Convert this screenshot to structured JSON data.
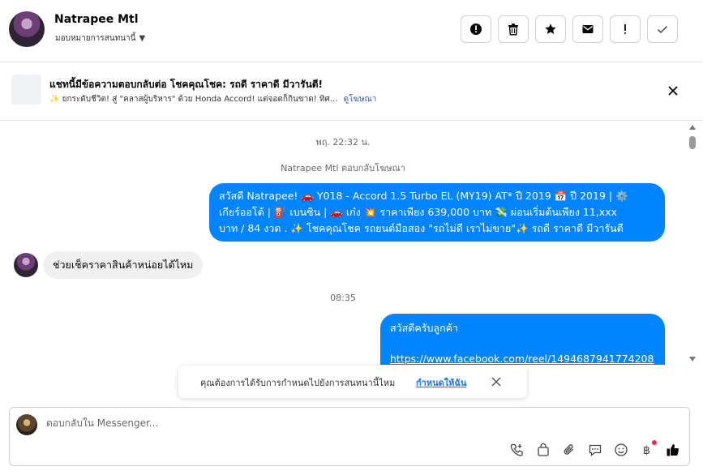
{
  "header": {
    "contact_name": "Natrapee Mtl",
    "assign_label": "มอบหมายการสนทนานี้",
    "actions": [
      {
        "name": "spam-button",
        "icon": "alert-circle-icon"
      },
      {
        "name": "delete-button",
        "icon": "trash-icon"
      },
      {
        "name": "star-button",
        "icon": "star-icon"
      },
      {
        "name": "mark-unread-button",
        "icon": "envelope-icon"
      },
      {
        "name": "follow-up-button",
        "icon": "exclamation-icon"
      },
      {
        "name": "mark-done-button",
        "icon": "check-icon"
      }
    ]
  },
  "banner": {
    "title": "แชทนี้มีข้อความตอบกลับต่อ โชคคุณโชค: รถดี ราคาดี มีวารันตี!",
    "subtitle": "✨ ยกระดับชีวิต! สู่ \"คลาสผู้บริหาร\" ด้วย Honda Accord! แต่จอดก็กินขาด! ทิศ...",
    "link": "ดูโฆษณา"
  },
  "messages": {
    "ts1": "พฤ. 22:32 น.",
    "meta1": "Natrapee Mtl ตอบกลับโฆษณา",
    "out1_line1": "สวัสดี Natrapee! 🚗 Y018 - Accord 1.5 Turbo EL (MY19) AT* ปี 2019 📅 ปี 2019 | ⚙️",
    "out1_line2": "เกียร์ออโต้ | ⛽ เบนซิน | 🚗 เก๋ง 💥 ราคาเพียง 639,000 บาท 💸 ผ่อนเริ่มต้นเพียง 11,xxx",
    "out1_line3": "บาท / 84 งวด . ✨ โชคคุณโชค รถยนต์มือสอง \"รถไม่ดี เราไม่ขาย\"✨ รถดี ราคาดี มีวารันตี",
    "in1": "ช่วยเช็คราคาสินค้าหน่อยได้ไหม",
    "ts2": "08:35",
    "out2_line1": "สวัสดีครับลูกค้า",
    "out2_link": "https://www.facebook.com/reel/1494687941774208"
  },
  "toast": {
    "text": "คุณต้องการได้รับการกำหนดไปยังการสนทนานี้ไหม",
    "link": "กำหนดให้ฉัน"
  },
  "composer": {
    "placeholder": "ตอบกลับใน Messenger..."
  },
  "colors": {
    "brand_blue": "#0084ff",
    "link_blue": "#1877f2",
    "notification_dot": "#f02849"
  }
}
